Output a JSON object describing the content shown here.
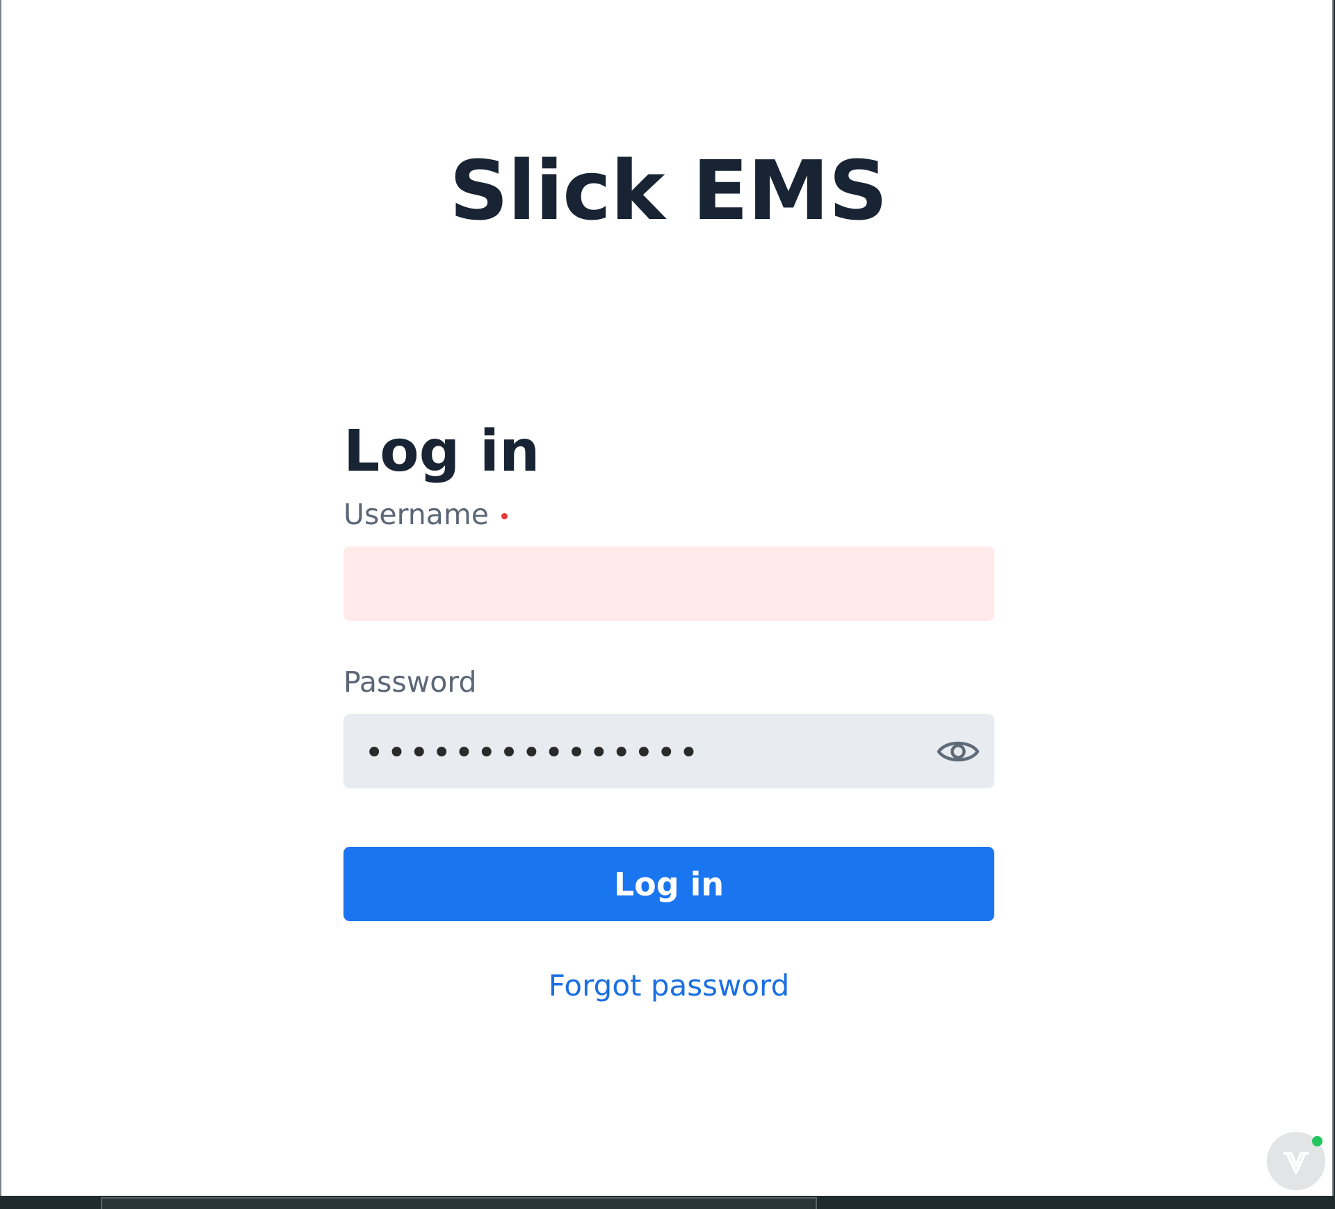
{
  "app": {
    "title": "Slick EMS"
  },
  "login": {
    "heading": "Log in",
    "username": {
      "label": "Username",
      "value": "",
      "placeholder": "",
      "required": true,
      "state_color": "#ffe9e9"
    },
    "password": {
      "label": "Password",
      "value": "•••••••••••••••",
      "toggle_icon": "eye-icon"
    },
    "submit_label": "Log in",
    "forgot_password_label": "Forgot password"
  },
  "colors": {
    "primary": "#1a75f0",
    "link": "#1a6fe0",
    "heading": "#182333",
    "label": "#5b6676",
    "required": "#e53935",
    "error_field_bg": "#ffe9e9",
    "field_bg": "#e8ebef"
  },
  "dev_tools_badge": {
    "icon": "devtools-logo-icon",
    "status_color": "#22c55e"
  }
}
